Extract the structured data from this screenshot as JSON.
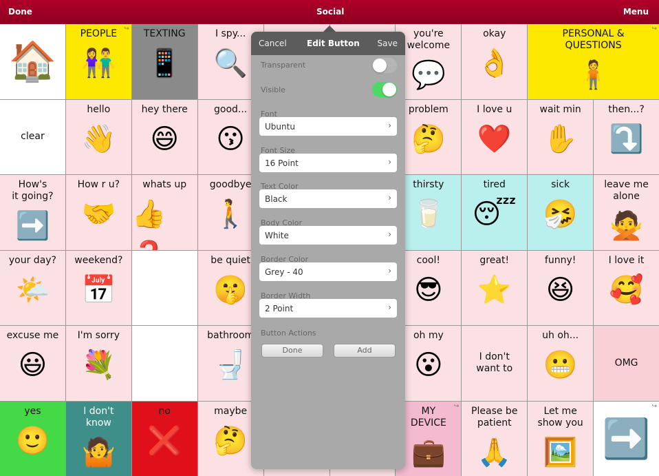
{
  "topbar": {
    "done": "Done",
    "title": "Social",
    "menu": "Menu"
  },
  "colors": {
    "bar": "#9e0024",
    "pink": "#fbe1e3",
    "yellow": "#fde800",
    "cyan": "#b9efec",
    "green": "#44d946",
    "teal": "#3e8f89",
    "red": "#e0101a",
    "gray": "#8a8a8a"
  },
  "cells": [
    {
      "label": "",
      "icon": "house-icon",
      "glyph": "🏠",
      "bg": "#ffffff"
    },
    {
      "label": "PEOPLE",
      "icon": "people-icon",
      "glyph": "👫",
      "bg": "#fde800",
      "folder": true
    },
    {
      "label": "TEXTING",
      "icon": "phone-texting-icon",
      "glyph": "📱",
      "bg": "#8a8a8a"
    },
    {
      "label": "I spy...",
      "icon": "magnifier-icon",
      "glyph": "🔍"
    },
    {
      "label": "",
      "icon": "",
      "glyph": ""
    },
    {
      "label": "",
      "icon": "",
      "glyph": ""
    },
    {
      "label": "you're\nwelcome",
      "icon": "talking-people-icon",
      "glyph": "💬"
    },
    {
      "label": "okay",
      "icon": "ok-hand-icon",
      "glyph": "👌"
    },
    {
      "label": "PERSONAL &\nQUESTIONS",
      "icon": "person-icon",
      "glyph": "🧍",
      "bg": "#fde800",
      "span": 2,
      "folder": true
    },
    {
      "label": "clear",
      "icon": "",
      "glyph": "",
      "bg": "#ffffff",
      "only": true
    },
    {
      "label": "hello",
      "icon": "waving-face-icon",
      "glyph": "👋"
    },
    {
      "label": "hey there",
      "icon": "smiling-face-icon",
      "glyph": "😄"
    },
    {
      "label": "good...",
      "icon": "two-faces-icon",
      "glyph": "😗"
    },
    {
      "label": "",
      "icon": "",
      "glyph": ""
    },
    {
      "label": "",
      "icon": "",
      "glyph": ""
    },
    {
      "label": "problem",
      "icon": "thinking-face-icon",
      "glyph": "🤔"
    },
    {
      "label": "I love u",
      "icon": "heart-icon",
      "glyph": "❤️"
    },
    {
      "label": "wait min",
      "icon": "hand-stop-icon",
      "glyph": "✋"
    },
    {
      "label": "then...?",
      "icon": "next-arrow-icon",
      "glyph": "⤵️"
    },
    {
      "label": "How's\nit going?",
      "icon": "green-arrow-icon",
      "glyph": "➡️"
    },
    {
      "label": "How r u?",
      "icon": "handshake-icon",
      "glyph": "🤝"
    },
    {
      "label": "whats up",
      "icon": "thumbs-question-icon",
      "glyph": "👍❓"
    },
    {
      "label": "goodbye",
      "icon": "waving-person-icon",
      "glyph": "🚶"
    },
    {
      "label": "",
      "icon": "",
      "glyph": ""
    },
    {
      "label": "",
      "icon": "",
      "glyph": ""
    },
    {
      "label": "thirsty",
      "icon": "glass-water-icon",
      "glyph": "🥛",
      "bg": "#b9efec"
    },
    {
      "label": "tired",
      "icon": "sleeping-face-icon",
      "glyph": "😴",
      "bg": "#b9efec"
    },
    {
      "label": "sick",
      "icon": "sick-face-icon",
      "glyph": "🤧",
      "bg": "#b9efec"
    },
    {
      "label": "leave me\nalone",
      "icon": "people-apart-icon",
      "glyph": "🙅"
    },
    {
      "label": "your day?",
      "icon": "sky-icon",
      "glyph": "🌤️"
    },
    {
      "label": "weekend?",
      "icon": "calendar-icon",
      "glyph": "📅"
    },
    {
      "label": "",
      "icon": "",
      "glyph": "",
      "bg": "#ffffff"
    },
    {
      "label": "be quiet",
      "icon": "shush-face-icon",
      "glyph": "🤫"
    },
    {
      "label": "",
      "icon": "",
      "glyph": ""
    },
    {
      "label": "",
      "icon": "",
      "glyph": ""
    },
    {
      "label": "cool!",
      "icon": "sunglasses-face-icon",
      "glyph": "😎"
    },
    {
      "label": "great!",
      "icon": "star-icon",
      "glyph": "⭐"
    },
    {
      "label": "funny!",
      "icon": "laughing-icon",
      "glyph": "😆"
    },
    {
      "label": "I love it",
      "icon": "hug-heart-icon",
      "glyph": "🥰"
    },
    {
      "label": "excuse me",
      "icon": "smiling-face-icon",
      "glyph": "😃"
    },
    {
      "label": "I'm sorry",
      "icon": "flowers-icon",
      "glyph": "💐"
    },
    {
      "label": "",
      "icon": "",
      "glyph": "",
      "bg": "#ffffff"
    },
    {
      "label": "bathroom",
      "icon": "toilet-icon",
      "glyph": "🚽"
    },
    {
      "label": "",
      "icon": "",
      "glyph": ""
    },
    {
      "label": "",
      "icon": "",
      "glyph": ""
    },
    {
      "label": "oh my",
      "icon": "surprised-face-icon",
      "glyph": "😮"
    },
    {
      "label": "I don't\nwant to",
      "icon": "",
      "glyph": "",
      "only": true
    },
    {
      "label": "uh oh...",
      "icon": "worried-face-icon",
      "glyph": "😬"
    },
    {
      "label": "OMG",
      "icon": "",
      "glyph": "",
      "bg": "#f8d0d6",
      "only": true
    },
    {
      "label": "yes",
      "icon": "smiling-face-icon",
      "glyph": "🙂",
      "bg": "#44d946"
    },
    {
      "label": "I don't\nknow",
      "icon": "shrug-icon",
      "glyph": "🤷",
      "bg": "#3e8f89"
    },
    {
      "label": "no",
      "icon": "red-x-icon",
      "glyph": "❌",
      "bg": "#e0101a"
    },
    {
      "label": "maybe",
      "icon": "question-face-icon",
      "glyph": "🤔"
    },
    {
      "label": "",
      "icon": "",
      "glyph": ""
    },
    {
      "label": "",
      "icon": "",
      "glyph": ""
    },
    {
      "label": "MY\nDEVICE",
      "icon": "device-icon",
      "glyph": "💼",
      "bg": "#f4bad0",
      "folder": true
    },
    {
      "label": "Please be\npatient",
      "icon": "waiting-person-icon",
      "glyph": "🙏"
    },
    {
      "label": "Let me\nshow you",
      "icon": "showing-picture-icon",
      "glyph": "🖼️"
    },
    {
      "label": "",
      "icon": "next-page-arrow-icon",
      "glyph": "➡️",
      "bg": "#ffffff",
      "folder": true
    }
  ],
  "popup": {
    "cancel": "Cancel",
    "title": "Edit Button",
    "save": "Save",
    "transparent_label": "Transparent",
    "transparent": false,
    "visible_label": "Visible",
    "visible": true,
    "fields": [
      {
        "label": "Font",
        "value": "Ubuntu"
      },
      {
        "label": "Font Size",
        "value": "16 Point"
      },
      {
        "label": "Text Color",
        "value": "Black"
      },
      {
        "label": "Body Color",
        "value": "White"
      },
      {
        "label": "Border Color",
        "value": "Grey - 40"
      },
      {
        "label": "Border Width",
        "value": "2 Point"
      }
    ],
    "actions_label": "Button Actions",
    "done": "Done",
    "add": "Add"
  }
}
